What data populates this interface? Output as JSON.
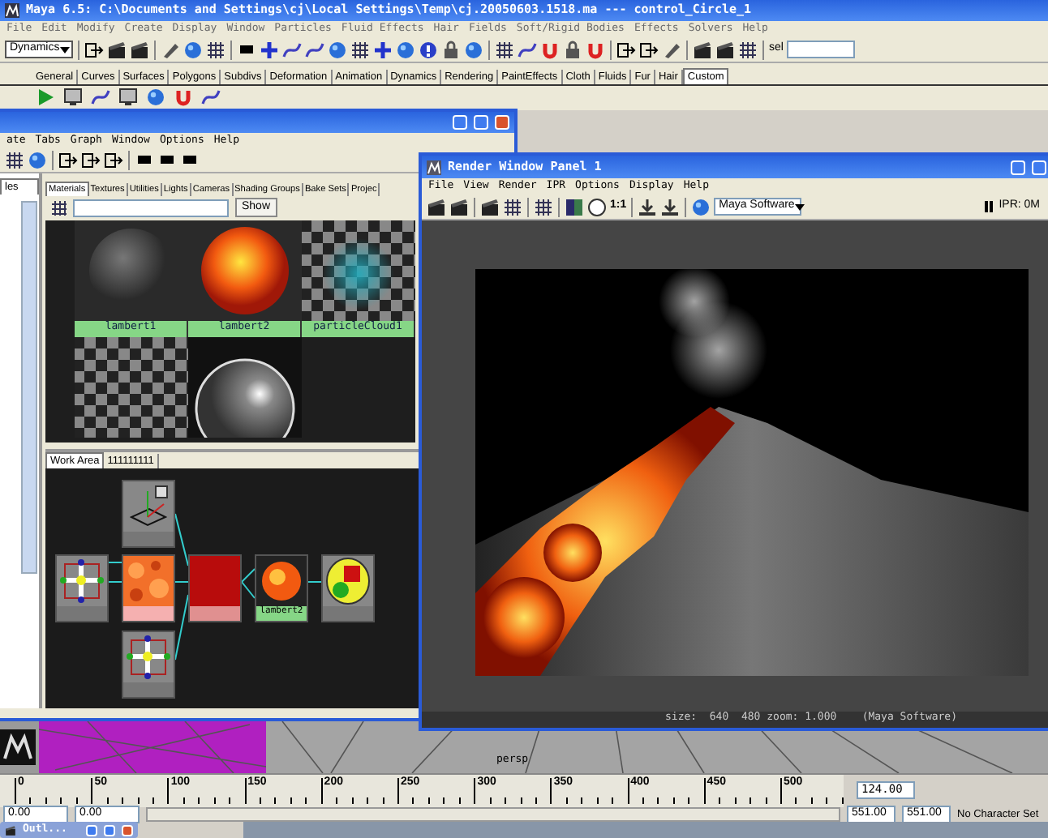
{
  "main_window": {
    "title": "Maya 6.5: C:\\Documents and Settings\\cj\\Local Settings\\Temp\\cj.20050603.1518.ma   ---   control_Circle_1",
    "menu": [
      "File",
      "Edit",
      "Modify",
      "Create",
      "Display",
      "Window",
      "Particles",
      "Fluid Effects",
      "Hair",
      "Fields",
      "Soft/Rigid Bodies",
      "Effects",
      "Solvers",
      "Help"
    ],
    "mode_select": "Dynamics",
    "selection_label": "sel",
    "shelf_tabs": [
      {
        "label": "General",
        "selected": false
      },
      {
        "label": "Curves",
        "selected": false
      },
      {
        "label": "Surfaces",
        "selected": false
      },
      {
        "label": "Polygons",
        "selected": false
      },
      {
        "label": "Subdivs",
        "selected": false
      },
      {
        "label": "Deformation",
        "selected": false
      },
      {
        "label": "Animation",
        "selected": false
      },
      {
        "label": "Dynamics",
        "selected": false
      },
      {
        "label": "Rendering",
        "selected": false
      },
      {
        "label": "PaintEffects",
        "selected": false
      },
      {
        "label": "Cloth",
        "selected": false
      },
      {
        "label": "Fluids",
        "selected": false
      },
      {
        "label": "Fur",
        "selected": false
      },
      {
        "label": "Hair",
        "selected": false
      },
      {
        "label": "Custom",
        "selected": true
      }
    ]
  },
  "hypershade": {
    "menu": [
      "ate",
      "Tabs",
      "Graph",
      "Window",
      "Options",
      "Help"
    ],
    "side_tab": "les",
    "tabs": [
      {
        "label": "Materials",
        "selected": true
      },
      {
        "label": "Textures",
        "selected": false
      },
      {
        "label": "Utilities",
        "selected": false
      },
      {
        "label": "Lights",
        "selected": false
      },
      {
        "label": "Cameras",
        "selected": false
      },
      {
        "label": "Shading Groups",
        "selected": false
      },
      {
        "label": "Bake Sets",
        "selected": false
      },
      {
        "label": "Projec",
        "selected": false
      }
    ],
    "search_button": "Show",
    "swatches": [
      {
        "kind": "gray-sphere",
        "label": "lambert1"
      },
      {
        "kind": "fire-sphere",
        "label": "lambert2"
      },
      {
        "kind": "cloud",
        "label": "particleCloud1"
      },
      {
        "kind": "checker"
      },
      {
        "kind": "shiny-sphere"
      }
    ],
    "work_tabs": [
      {
        "label": "Work Area",
        "selected": true
      },
      {
        "label": "111111111",
        "selected": false
      }
    ],
    "nodes": [
      {
        "kind": "placement"
      },
      {
        "kind": "place2d"
      },
      {
        "kind": "noise"
      },
      {
        "kind": "place2d"
      },
      {
        "kind": "ramp"
      },
      {
        "kind": "fire-sphere",
        "label": "lambert2"
      },
      {
        "kind": "shading-group"
      }
    ]
  },
  "render_window": {
    "title": "Render Window Panel 1",
    "menu": [
      "File",
      "View",
      "Render",
      "IPR",
      "Options",
      "Display",
      "Help"
    ],
    "ratio_label": "1:1",
    "renderer": "Maya Software",
    "ipr_label": "IPR: 0M",
    "status": "size:  640  480 zoom: 1.000    (Maya Software)"
  },
  "viewport": {
    "camera_label": "persp"
  },
  "timeline": {
    "ticks": [
      "0",
      "50",
      "100",
      "150",
      "200",
      "250",
      "300",
      "350",
      "400",
      "450",
      "500"
    ],
    "current_frame": "124.00"
  },
  "range_slider": {
    "start": "0.00",
    "inner_start": "0.00",
    "inner_end": "551.00",
    "end": "551.00",
    "character_set": "No Character Set"
  },
  "taskbar": [
    {
      "label": "Outl..."
    }
  ]
}
